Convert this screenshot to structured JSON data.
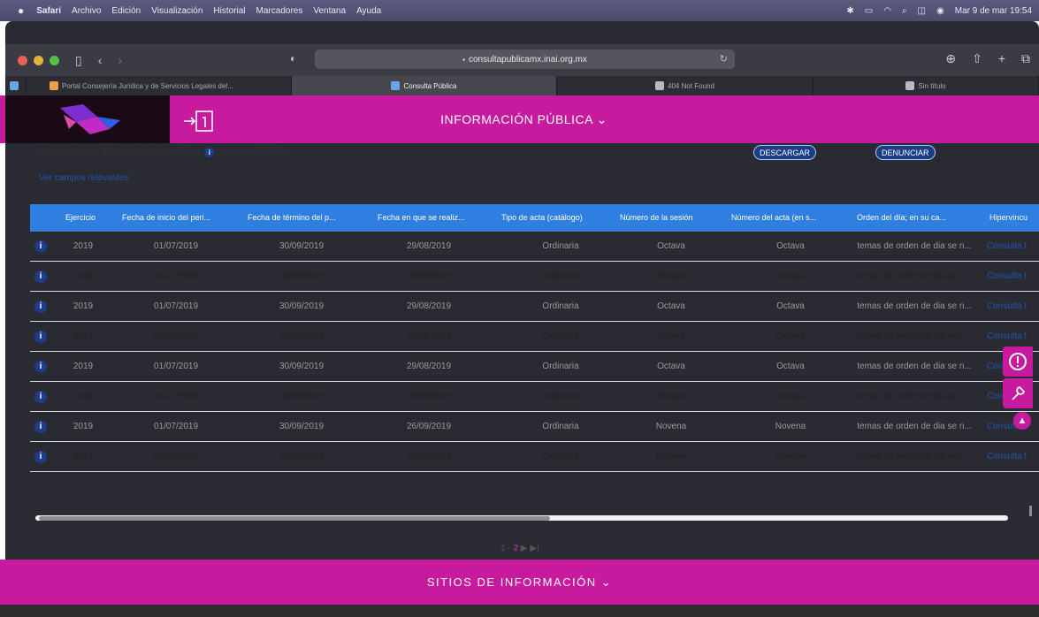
{
  "menubar": {
    "apple_icon": "apple-icon",
    "items": [
      "Safari",
      "Archivo",
      "Edición",
      "Visualización",
      "Historial",
      "Marcadores",
      "Ventana",
      "Ayuda"
    ],
    "clock": "Mar 9 de mar  19:54"
  },
  "browser": {
    "url": "consultapublicamx.inai.org.mx",
    "tabs": [
      {
        "label": "Portal Consejería Jurídica y de Servicios Legales del..."
      },
      {
        "label": "Consulta Pública"
      },
      {
        "label": "404 Not Found"
      },
      {
        "label": "Sin título"
      }
    ]
  },
  "header": {
    "title": "INFORMACIÓN PÚBLICA ⌄"
  },
  "results": {
    "prefix": "Se encontraron ",
    "count": "294",
    "suffix_a": " resultados, da clic en ",
    "suffix_b": " para ver el detalle.",
    "download_label": "DESCARGAR",
    "report_label": "DENUNCIAR",
    "fields_link": "Ver campos relevantes"
  },
  "table": {
    "headers": [
      "Ejercicio",
      "Fecha de inicio del peri...",
      "Fecha de término del p...",
      "Fecha en que se realiz...",
      "Tipo de acta (catálogo)",
      "Número de la sesión",
      "Número del acta (en s...",
      "Orden del día; en su ca...",
      "Hipervíncu"
    ],
    "rows": [
      [
        "2019",
        "01/07/2019",
        "30/09/2019",
        "29/08/2019",
        "Ordinaria",
        "Octava",
        "Octava",
        "temas de orden de dia se n...",
        "Consulta I"
      ],
      [
        "2019",
        "01/07/2019",
        "30/09/2019",
        "29/08/2019",
        "Ordinaria",
        "Octava",
        "Octava",
        "temas de orden de dia se n...",
        "Consulta I"
      ],
      [
        "2019",
        "01/07/2019",
        "30/09/2019",
        "29/08/2019",
        "Ordinaria",
        "Octava",
        "Octava",
        "temas de orden de dia se n...",
        "Consulta I"
      ],
      [
        "2019",
        "01/07/2019",
        "30/09/2019",
        "29/08/2019",
        "Ordinaria",
        "Octava",
        "Octava",
        "temas de orden de dia se n...",
        "Consulta I"
      ],
      [
        "2019",
        "01/07/2019",
        "30/09/2019",
        "29/08/2019",
        "Ordinaria",
        "Octava",
        "Octava",
        "temas de orden de dia se n...",
        "Con"
      ],
      [
        "2019",
        "01/07/2019",
        "30/09/2019",
        "29/08/2019",
        "Ordinaria",
        "Octava",
        "Octava",
        "temas de orden de dia se n...",
        "Consu"
      ],
      [
        "2019",
        "01/07/2019",
        "30/09/2019",
        "26/09/2019",
        "Ordinaria",
        "Novena",
        "Novena",
        "temas de orden de dia se n...",
        "Consulta I"
      ],
      [
        "2019",
        "01/07/2019",
        "30/09/2019",
        "26/09/2019",
        "Ordinaria",
        "Novena",
        "Novena",
        "temas de orden de dia se n...",
        "Consulta I"
      ]
    ]
  },
  "pager": {
    "prefix": "1 - ",
    "current": "2",
    "controls": "▶ ▶|"
  },
  "footer": {
    "title": "SITIOS DE INFORMACIÓN ⌄"
  },
  "colors": {
    "brand_magenta": "#c81a9e",
    "table_header_blue": "#2f7fe0",
    "button_navy": "#1b3c86"
  }
}
